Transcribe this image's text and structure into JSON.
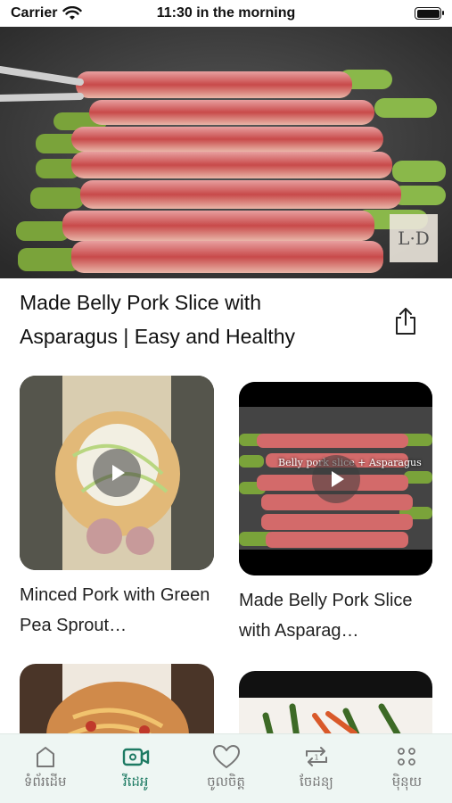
{
  "status_bar": {
    "carrier": "Carrier",
    "time": "11:30 in the morning"
  },
  "hero": {
    "watermark": "L·D"
  },
  "video": {
    "title": "Made Belly Pork Slice with Asparagus | Easy and Healthy"
  },
  "related": [
    {
      "caption": "Minced Pork with Green Pea Sprout…"
    },
    {
      "caption": "Made Belly Pork Slice with Asparag…",
      "overlay_text": "Belly pork slice + Asparagus"
    }
  ],
  "tabs": [
    {
      "label": "ទំព័រដើម",
      "icon": "home-icon"
    },
    {
      "label": "វីដេអូ",
      "icon": "video-icon",
      "active": true
    },
    {
      "label": "ចូលចិត្ត",
      "icon": "heart-icon"
    },
    {
      "label": "ចែដន្យ",
      "icon": "shuffle-icon"
    },
    {
      "label": "មុិនុយ",
      "icon": "menu-grid-icon"
    }
  ],
  "colors": {
    "accent": "#1d7a63",
    "tab_bar_bg": "#eef6f3"
  }
}
